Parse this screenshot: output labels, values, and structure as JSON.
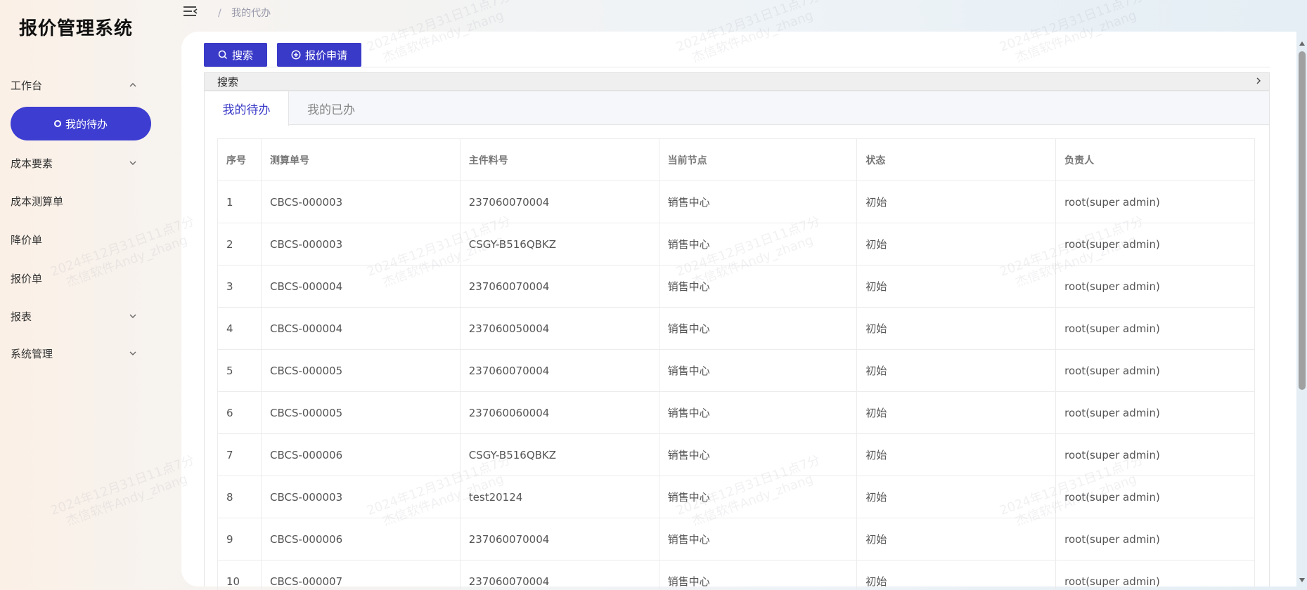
{
  "app": {
    "title": "报价管理系统"
  },
  "sidebar": {
    "items": [
      {
        "label": "工作台",
        "chevron": "up"
      },
      {
        "label": "我的待办",
        "active": true
      },
      {
        "label": "成本要素",
        "chevron": "down"
      },
      {
        "label": "成本测算单"
      },
      {
        "label": "降价单"
      },
      {
        "label": "报价单"
      },
      {
        "label": "报表",
        "chevron": "down"
      },
      {
        "label": "系统管理",
        "chevron": "down"
      }
    ]
  },
  "header": {
    "breadcrumb_sep": "/",
    "breadcrumb_current": "我的代办"
  },
  "toolbar": {
    "search_label": "搜索",
    "apply_label": "报价申请"
  },
  "search_panel": {
    "label": "搜索"
  },
  "tabs": [
    {
      "label": "我的待办",
      "active": true
    },
    {
      "label": "我的已办",
      "active": false
    }
  ],
  "table": {
    "headers": [
      "序号",
      "测算单号",
      "主件料号",
      "当前节点",
      "状态",
      "负责人"
    ],
    "rows": [
      [
        "1",
        "CBCS-000003",
        "237060070004",
        "销售中心",
        "初始",
        "root(super admin)"
      ],
      [
        "2",
        "CBCS-000003",
        "CSGY-B516QBKZ",
        "销售中心",
        "初始",
        "root(super admin)"
      ],
      [
        "3",
        "CBCS-000004",
        "237060070004",
        "销售中心",
        "初始",
        "root(super admin)"
      ],
      [
        "4",
        "CBCS-000004",
        "237060050004",
        "销售中心",
        "初始",
        "root(super admin)"
      ],
      [
        "5",
        "CBCS-000005",
        "237060070004",
        "销售中心",
        "初始",
        "root(super admin)"
      ],
      [
        "6",
        "CBCS-000005",
        "237060060004",
        "销售中心",
        "初始",
        "root(super admin)"
      ],
      [
        "7",
        "CBCS-000006",
        "CSGY-B516QBKZ",
        "销售中心",
        "初始",
        "root(super admin)"
      ],
      [
        "8",
        "CBCS-000003",
        "test20124",
        "销售中心",
        "初始",
        "root(super admin)"
      ],
      [
        "9",
        "CBCS-000006",
        "237060070004",
        "销售中心",
        "初始",
        "root(super admin)"
      ],
      [
        "10",
        "CBCS-000007",
        "237060070004",
        "销售中心",
        "初始",
        "root(super admin)"
      ]
    ]
  },
  "watermark": {
    "line1": "2024年12月31日11点7分",
    "line2": "杰信软件Andy_zhang"
  },
  "colors": {
    "accent": "#3a3ac8",
    "active_menu": "#3d3dd1"
  }
}
